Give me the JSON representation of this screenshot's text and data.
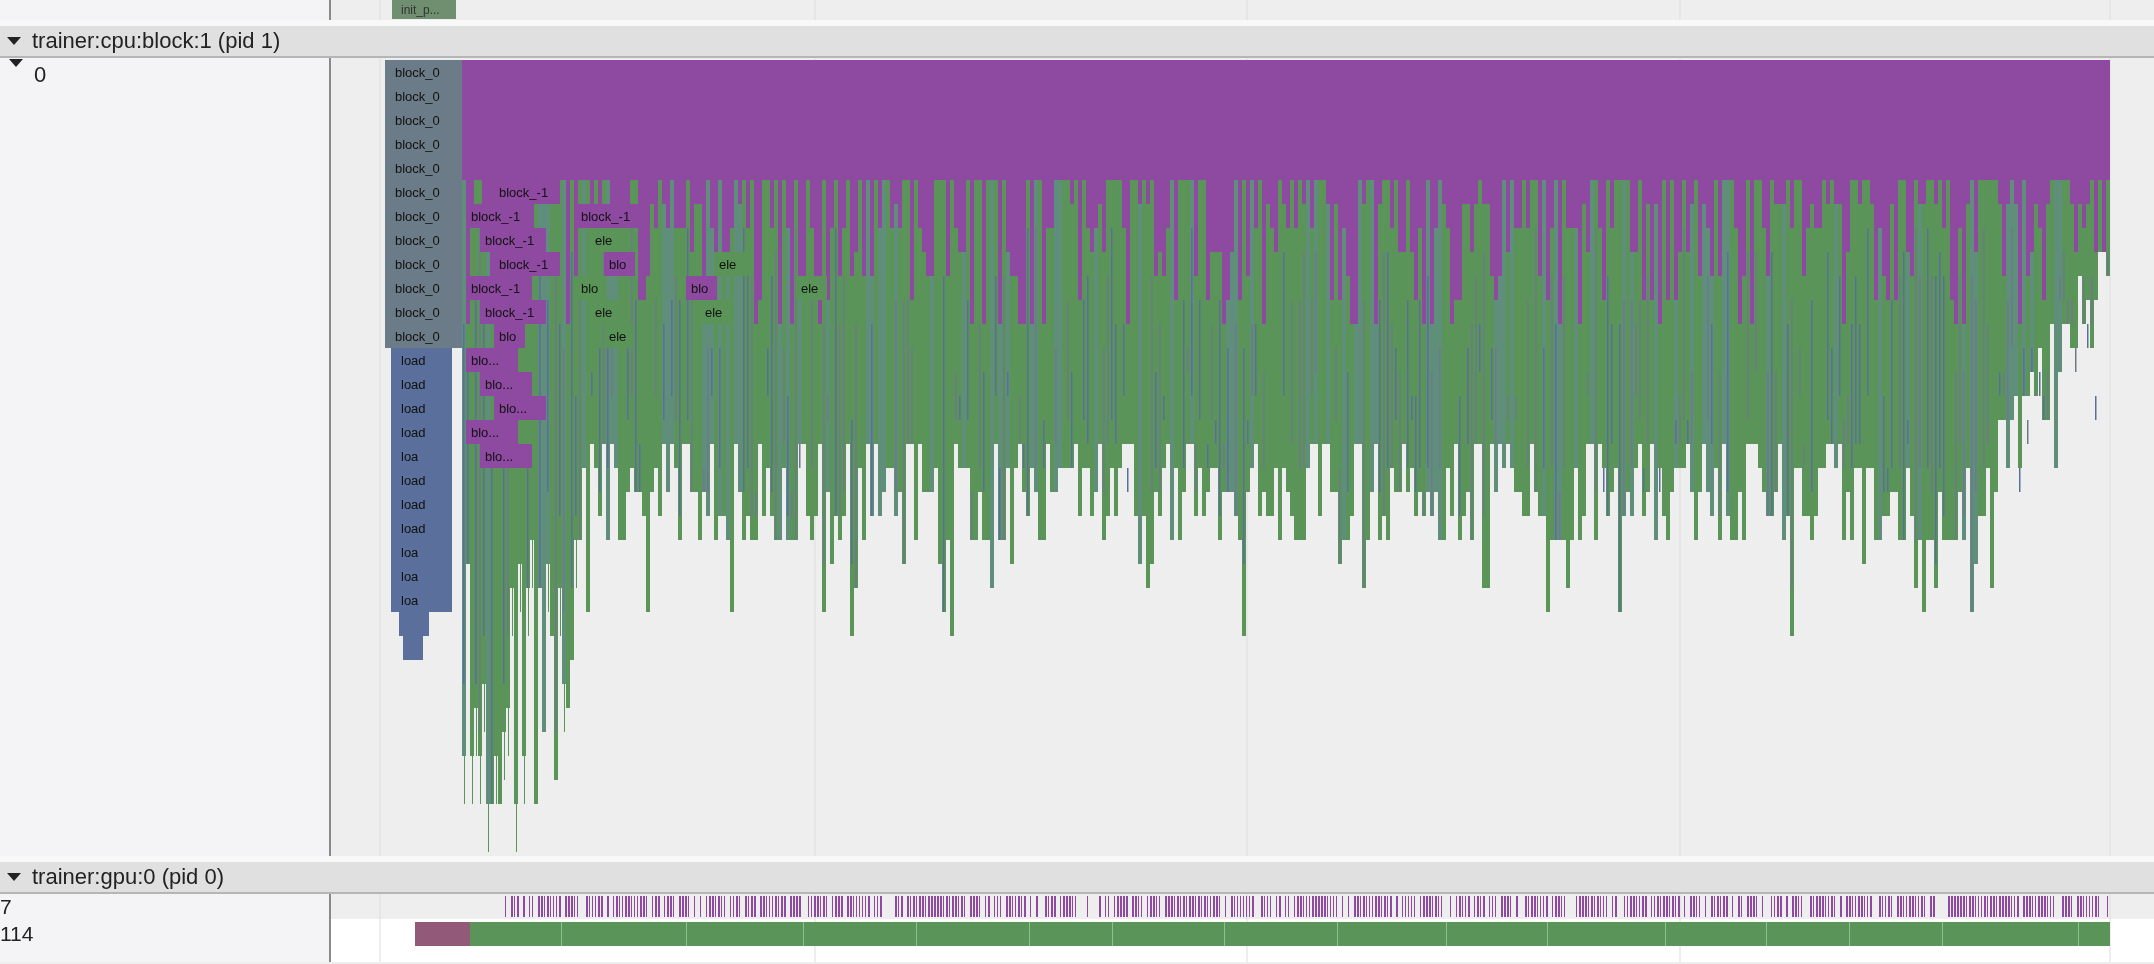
{
  "top_track": {
    "slices": [
      {
        "label": "init_p...",
        "kind": "init"
      }
    ]
  },
  "processes": [
    {
      "title": "trainer:cpu:block:1 (pid 1)",
      "expanded": true,
      "threads": [
        {
          "name": "0",
          "expanded": true,
          "kind": "flame",
          "rows": [
            {
              "slices": [
                {
                  "label": "block_0",
                  "kind": "host"
                }
              ]
            },
            {
              "slices": [
                {
                  "label": "block_0",
                  "kind": "host"
                }
              ]
            },
            {
              "slices": [
                {
                  "label": "block_0",
                  "kind": "host"
                }
              ]
            },
            {
              "slices": [
                {
                  "label": "block_0",
                  "kind": "host"
                }
              ]
            },
            {
              "slices": [
                {
                  "label": "block_0",
                  "kind": "host"
                }
              ]
            },
            {
              "slices": [
                {
                  "label": "block_0",
                  "kind": "host"
                },
                {
                  "label": "block_-1",
                  "kind": "block"
                }
              ]
            },
            {
              "slices": [
                {
                  "label": "block_0",
                  "kind": "host"
                },
                {
                  "label": "block_-1",
                  "kind": "block"
                },
                {
                  "label": "block_-1",
                  "kind": "block"
                }
              ]
            },
            {
              "slices": [
                {
                  "label": "block_0",
                  "kind": "host"
                },
                {
                  "label": "block_-1",
                  "kind": "block"
                },
                {
                  "label": "ele",
                  "kind": "op"
                }
              ]
            },
            {
              "slices": [
                {
                  "label": "block_0",
                  "kind": "host"
                },
                {
                  "label": "block_-1",
                  "kind": "block"
                },
                {
                  "label": "blo",
                  "kind": "block"
                },
                {
                  "label": "ele",
                  "kind": "op"
                }
              ]
            },
            {
              "slices": [
                {
                  "label": "block_0",
                  "kind": "host"
                },
                {
                  "label": "block_-1",
                  "kind": "block"
                },
                {
                  "label": "blo",
                  "kind": "op"
                },
                {
                  "label": "blo",
                  "kind": "block"
                },
                {
                  "label": "ele",
                  "kind": "op"
                }
              ]
            },
            {
              "slices": [
                {
                  "label": "block_0",
                  "kind": "host"
                },
                {
                  "label": "block_-1",
                  "kind": "block"
                },
                {
                  "label": "ele",
                  "kind": "op"
                },
                {
                  "label": "ele",
                  "kind": "op"
                }
              ]
            },
            {
              "slices": [
                {
                  "label": "block_0",
                  "kind": "host"
                },
                {
                  "label": "blo",
                  "kind": "block"
                },
                {
                  "label": "ele",
                  "kind": "op"
                }
              ]
            },
            {
              "slices": [
                {
                  "label": "load",
                  "kind": "load"
                },
                {
                  "label": "blo...",
                  "kind": "block"
                }
              ]
            },
            {
              "slices": [
                {
                  "label": "load",
                  "kind": "load"
                },
                {
                  "label": "blo...",
                  "kind": "block"
                }
              ]
            },
            {
              "slices": [
                {
                  "label": "load",
                  "kind": "load"
                },
                {
                  "label": "blo...",
                  "kind": "block"
                }
              ]
            },
            {
              "slices": [
                {
                  "label": "load",
                  "kind": "load"
                },
                {
                  "label": "blo...",
                  "kind": "block"
                }
              ]
            },
            {
              "slices": [
                {
                  "label": "loa",
                  "kind": "load"
                },
                {
                  "label": "blo...",
                  "kind": "block"
                }
              ]
            },
            {
              "slices": [
                {
                  "label": "load",
                  "kind": "load"
                }
              ]
            },
            {
              "slices": [
                {
                  "label": "load",
                  "kind": "load"
                }
              ]
            },
            {
              "slices": [
                {
                  "label": "load",
                  "kind": "load"
                }
              ]
            },
            {
              "slices": [
                {
                  "label": "loa",
                  "kind": "load"
                }
              ]
            },
            {
              "slices": [
                {
                  "label": "loa",
                  "kind": "load"
                }
              ]
            },
            {
              "slices": [
                {
                  "label": "loa",
                  "kind": "load"
                }
              ]
            }
          ]
        }
      ]
    },
    {
      "title": "trainer:gpu:0 (pid 0)",
      "expanded": true,
      "threads": [
        {
          "name": "7",
          "kind": "ticks"
        },
        {
          "name": "114",
          "kind": "bar"
        }
      ]
    }
  ]
}
